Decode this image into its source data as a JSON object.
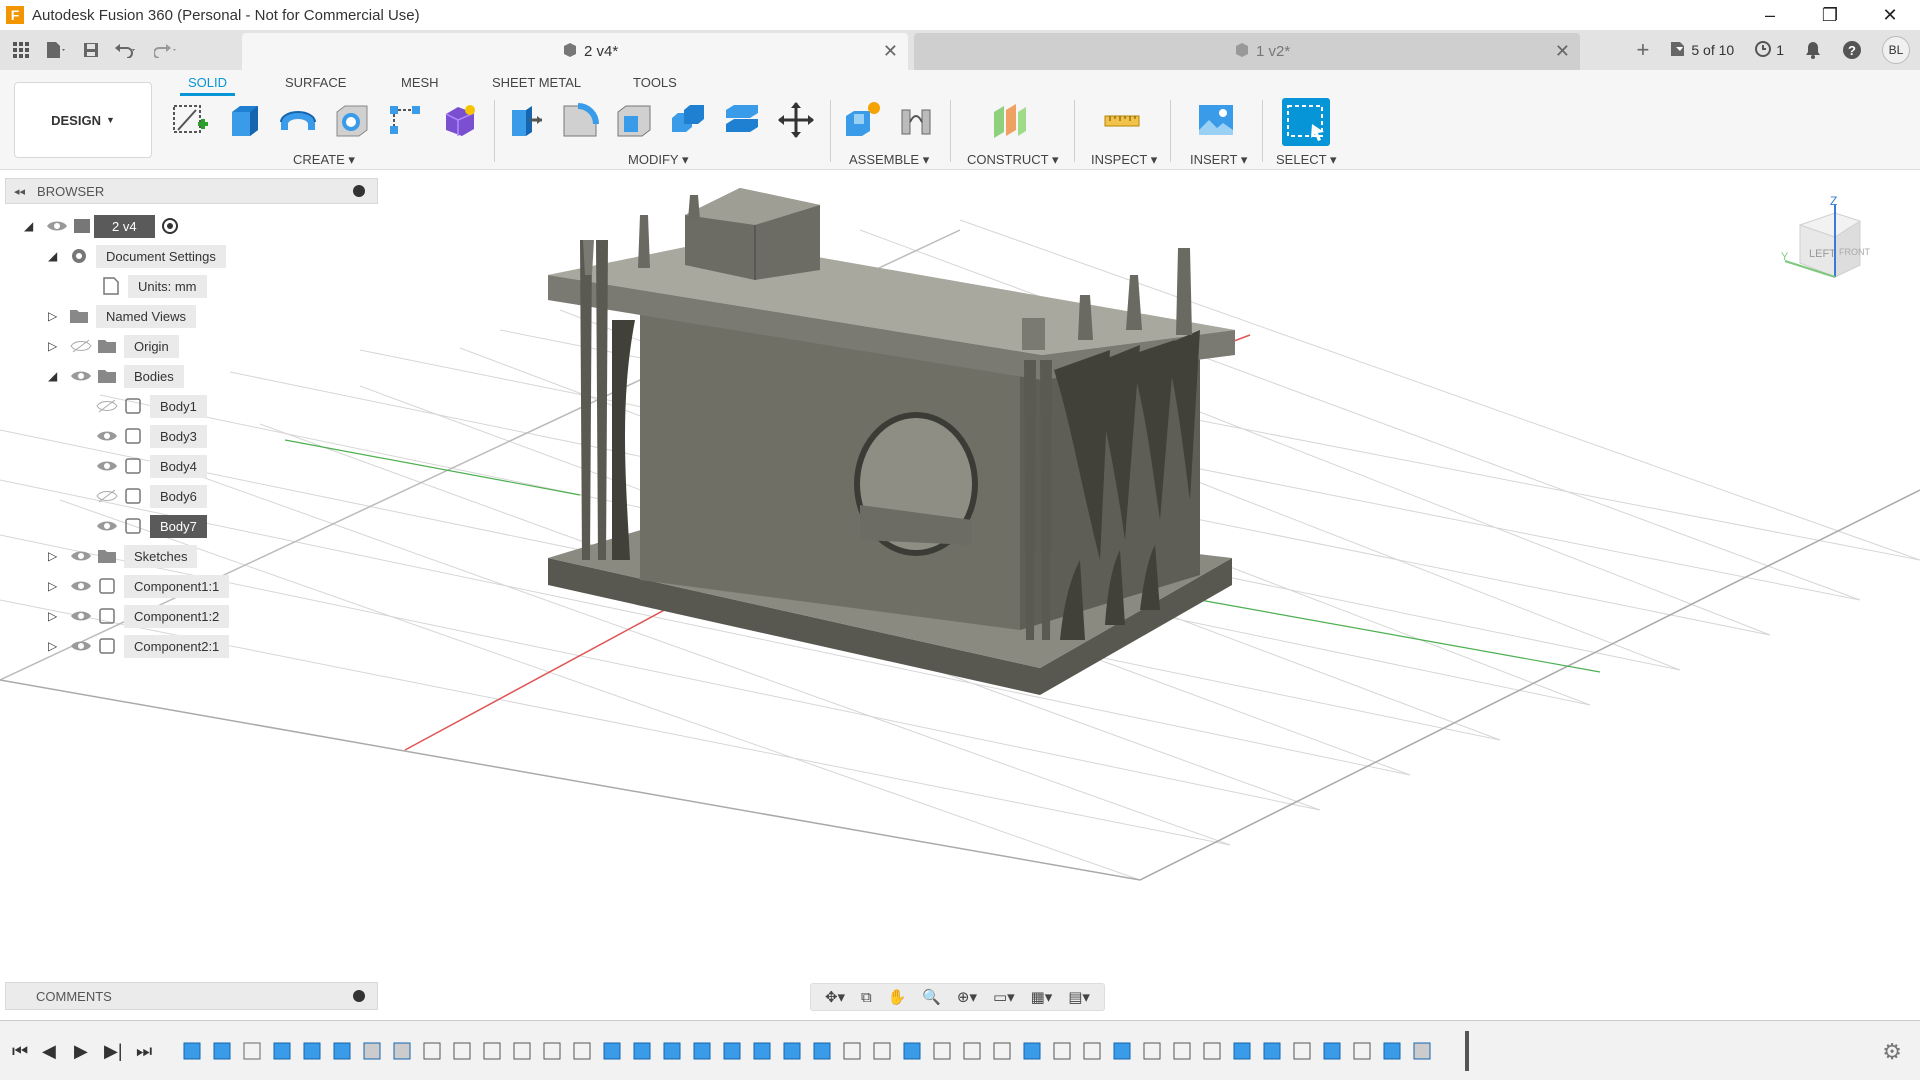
{
  "window": {
    "title": "Autodesk Fusion 360 (Personal - Not for Commercial Use)",
    "app_icon_letter": "F",
    "controls": [
      "–",
      "❐",
      "✕"
    ]
  },
  "tabs": [
    {
      "label": "2 v4*",
      "active": true
    },
    {
      "label": "1 v2*",
      "active": false
    }
  ],
  "tab_right": {
    "add": "+",
    "jobs": "5 of 10",
    "clock_count": "1",
    "user_initials": "BL"
  },
  "ribbon": {
    "workspace": "DESIGN",
    "tabs": [
      "SOLID",
      "SURFACE",
      "MESH",
      "SHEET METAL",
      "TOOLS"
    ],
    "groups": [
      "CREATE",
      "MODIFY",
      "ASSEMBLE",
      "CONSTRUCT",
      "INSPECT",
      "INSERT",
      "SELECT"
    ]
  },
  "browser": {
    "title": "BROWSER",
    "root": "2 v4",
    "items": [
      {
        "label": "Document Settings"
      },
      {
        "label": "Units: mm"
      },
      {
        "label": "Named Views"
      },
      {
        "label": "Origin"
      },
      {
        "label": "Bodies"
      },
      {
        "label": "Body1"
      },
      {
        "label": "Body3"
      },
      {
        "label": "Body4"
      },
      {
        "label": "Body6"
      },
      {
        "label": "Body7"
      },
      {
        "label": "Sketches"
      },
      {
        "label": "Component1:1"
      },
      {
        "label": "Component1:2"
      },
      {
        "label": "Component2:1"
      }
    ]
  },
  "viewcube": {
    "front": "LEFT",
    "right": "FRONT",
    "axis_z": "Z",
    "axis_y": "Y"
  },
  "comments": {
    "title": "COMMENTS"
  },
  "colors": {
    "accent": "#0696d7",
    "body": "#6e6e64",
    "grid": "#d6d6d6",
    "x_axis": "#e05555",
    "y_axis": "#4caf50"
  }
}
